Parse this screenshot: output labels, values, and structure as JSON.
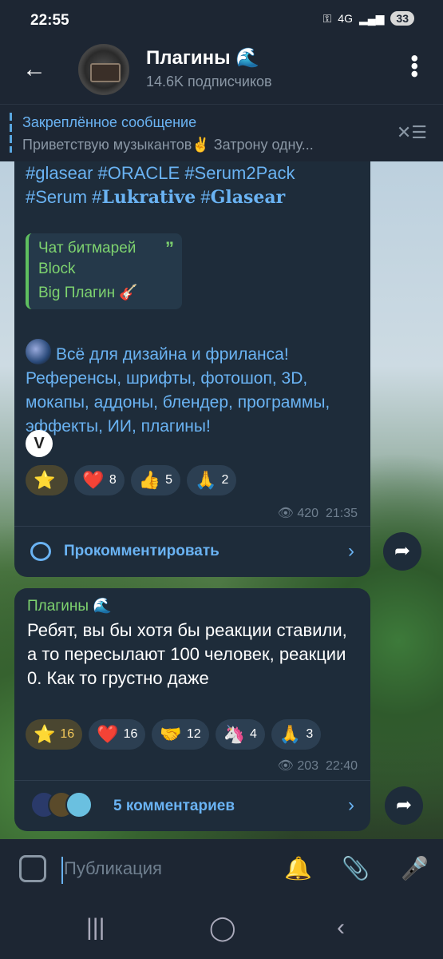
{
  "status": {
    "time": "22:55",
    "network": "4G",
    "battery": "33"
  },
  "header": {
    "title": "Плагины 🌊",
    "subtitle": "14.6K подписчиков"
  },
  "pinned": {
    "title": "Закреплённое сообщение",
    "text": "Приветствую музыкантов✌️ Затрону одну..."
  },
  "post1": {
    "tags_line1": "#glasear #ORACLE #Serum2Pack",
    "tags_line2_a": "#Serum #",
    "tags_line2_b": "Lukrative",
    "tags_line2_c": " #",
    "tags_line2_d": "Glasear",
    "quote": [
      "Чат битмарей",
      "Block",
      "Big Плагин 🎸"
    ],
    "promo": "Всё для дизайна и фриланса! Референсы, шрифты, фотошоп, 3D, мокапы, аддоны, блендер, программы, эффекты, ИИ, плагины!",
    "reactions": [
      {
        "emoji": "⭐",
        "count": ""
      },
      {
        "emoji": "❤️",
        "count": "8"
      },
      {
        "emoji": "👍",
        "count": "5"
      },
      {
        "emoji": "🙏",
        "count": "2"
      }
    ],
    "views": "420",
    "time": "21:35",
    "comment_label": "Прокомментировать"
  },
  "post2": {
    "author": "Плагины 🌊",
    "text": "Ребят, вы бы хотя бы реакции ставили, а то пересылают 100 человек, реакции 0. Как то грустно даже",
    "reactions": [
      {
        "emoji": "⭐",
        "count": "16"
      },
      {
        "emoji": "❤️",
        "count": "16"
      },
      {
        "emoji": "🤝",
        "count": "12"
      },
      {
        "emoji": "🦄",
        "count": "4"
      },
      {
        "emoji": "🙏",
        "count": "3"
      }
    ],
    "views": "203",
    "time": "22:40",
    "comments_label": "5 комментариев"
  },
  "composer": {
    "placeholder": "Публикация"
  },
  "icons": {
    "back": "back-arrow-icon",
    "menu": "more-vert-icon",
    "pin": "unpin-icon",
    "mic": "mic-icon",
    "attach": "attach-icon",
    "bell": "bell-icon"
  },
  "colors": {
    "accent": "#6ab3f3",
    "green": "#7ed36f",
    "bubble": "#1e2c3a",
    "bar": "#1d2633"
  }
}
